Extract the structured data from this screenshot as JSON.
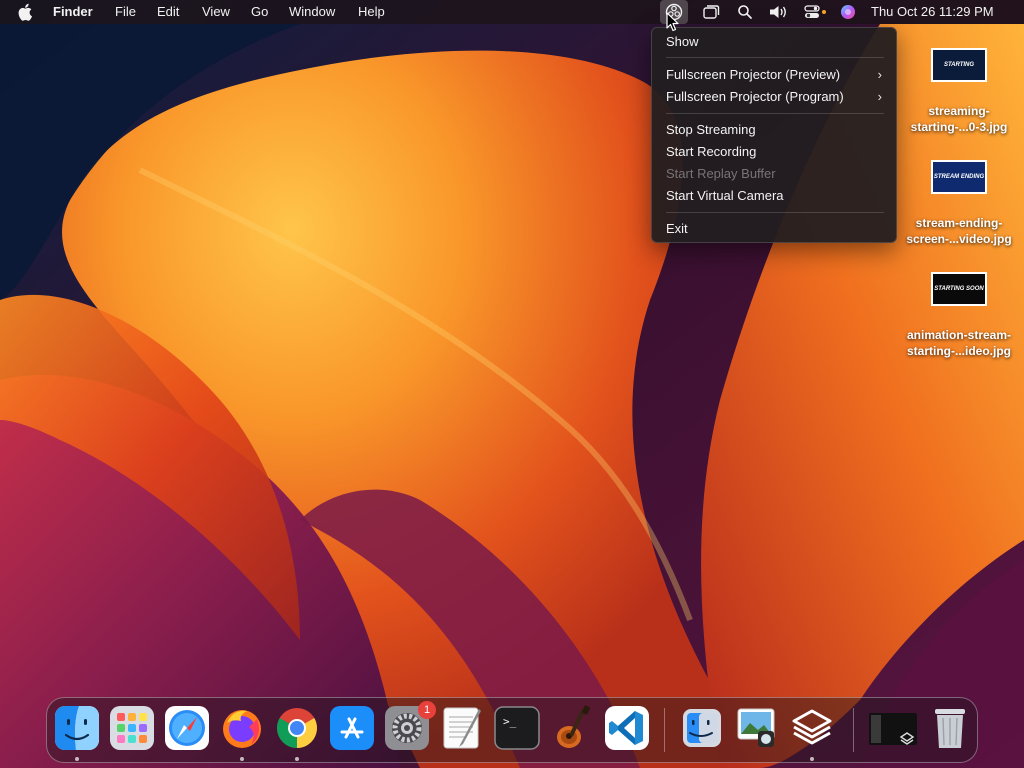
{
  "menubar": {
    "app_name": "Finder",
    "menus": [
      "File",
      "Edit",
      "View",
      "Go",
      "Window",
      "Help"
    ],
    "clock": "Thu Oct 26  11:29 PM",
    "status_icons": [
      "obs-icon",
      "window-icon",
      "spotlight-search-icon",
      "volume-icon",
      "control-center-icon",
      "siri-icon"
    ]
  },
  "dropdown": {
    "items": [
      {
        "label": "Show",
        "enabled": true,
        "submenu": false
      },
      {
        "label": "Fullscreen Projector (Preview)",
        "enabled": true,
        "submenu": true
      },
      {
        "label": "Fullscreen Projector (Program)",
        "enabled": true,
        "submenu": true
      },
      {
        "label": "Stop Streaming",
        "enabled": true,
        "submenu": false
      },
      {
        "label": "Start Recording",
        "enabled": true,
        "submenu": false
      },
      {
        "label": "Start Replay Buffer",
        "enabled": false,
        "submenu": false
      },
      {
        "label": "Start Virtual Camera",
        "enabled": true,
        "submenu": false
      },
      {
        "label": "Exit",
        "enabled": true,
        "submenu": false
      }
    ],
    "submenu_glyph": "›"
  },
  "desktop_files": [
    {
      "line1": "streaming-",
      "line2": "starting-...0-3.jpg",
      "thumb_text": "STARTING",
      "thumb_color": "#0b1b3a"
    },
    {
      "line1": "stream-ending-",
      "line2": "screen-...video.jpg",
      "thumb_text": "STREAM ENDING",
      "thumb_color": "#0f2a6e"
    },
    {
      "line1": "animation-stream-",
      "line2": "starting-...ideo.jpg",
      "thumb_text": "STARTING SOON",
      "thumb_color": "#0a0a0a"
    }
  ],
  "dock": {
    "apps": [
      "finder-icon",
      "launchpad-icon",
      "safari-icon",
      "firefox-icon",
      "chrome-icon",
      "app-store-icon",
      "system-settings-icon",
      "textedit-icon",
      "terminal-icon",
      "garageband-icon",
      "vscode-icon",
      "migration-assistant-icon",
      "preview-icon",
      "obs-studio-icon",
      "screen-recording-icon",
      "trash-icon"
    ],
    "settings_badge": "1",
    "terminal_prompt": ">_"
  },
  "colors": {
    "wallpaper_orange": "#f5a623",
    "wallpaper_red": "#d9341c",
    "wallpaper_purple": "#6a1a4c",
    "wallpaper_dark": "#0e1a3a",
    "badge_red": "#e8403a"
  }
}
